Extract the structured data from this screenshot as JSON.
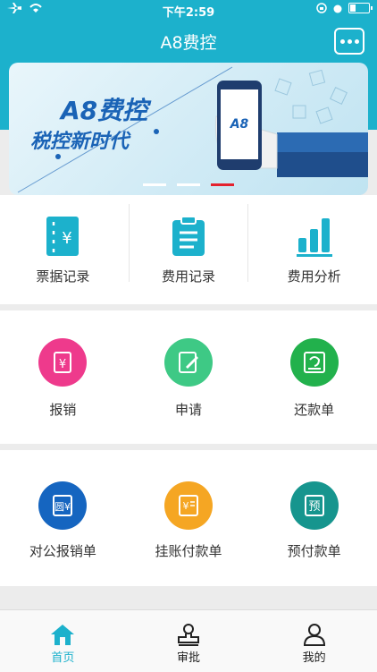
{
  "status_bar": {
    "time": "下午2:59"
  },
  "header": {
    "title": "A8费控",
    "more_icon": "more-dots-icon"
  },
  "banner": {
    "title_line1": "A8费控",
    "title_line2": "税控新时代",
    "phone_text": "A8",
    "active_slide": 3,
    "slides": 3
  },
  "top_menu": [
    {
      "label": "票据记录",
      "icon": "receipt-yuan-icon"
    },
    {
      "label": "费用记录",
      "icon": "clipboard-icon"
    },
    {
      "label": "费用分析",
      "icon": "bar-chart-icon"
    }
  ],
  "section2": [
    {
      "label": "报销",
      "icon": "reimburse-icon",
      "color": "#ee3a8c"
    },
    {
      "label": "申请",
      "icon": "apply-edit-icon",
      "color": "#3ec985"
    },
    {
      "label": "还款单",
      "icon": "repayment-icon",
      "color": "#22b14c"
    }
  ],
  "section3": [
    {
      "label": "对公报销单",
      "icon": "corporate-reimburse-icon",
      "color": "#1565c0"
    },
    {
      "label": "挂账付款单",
      "icon": "account-payment-icon",
      "color": "#f5a623"
    },
    {
      "label": "预付款单",
      "icon": "prepayment-icon",
      "color": "#16958e"
    }
  ],
  "tabbar": [
    {
      "label": "首页",
      "icon": "home-icon"
    },
    {
      "label": "审批",
      "icon": "approval-stamp-icon"
    },
    {
      "label": "我的",
      "icon": "user-profile-icon"
    }
  ],
  "colors": {
    "primary": "#1cb1cc",
    "active_dot": "#e4222e"
  }
}
